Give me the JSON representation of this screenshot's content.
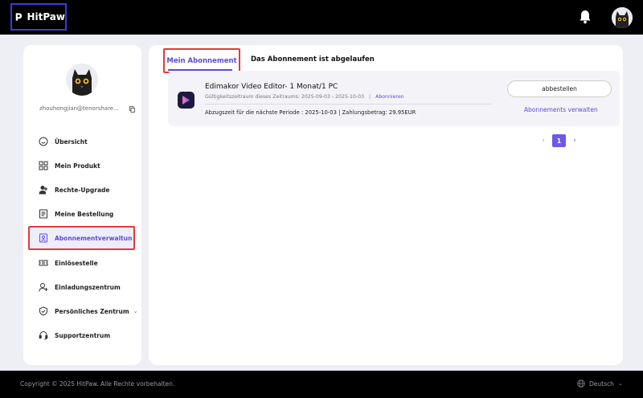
{
  "header": {
    "logo_text": "HitPaw"
  },
  "sidebar": {
    "email": "zhouhongjian@tenorshare...",
    "items": [
      {
        "label": "Übersicht",
        "icon": "smile-icon"
      },
      {
        "label": "Mein Produkt",
        "icon": "grid-icon"
      },
      {
        "label": "Rechte-Upgrade",
        "icon": "user-plus-icon"
      },
      {
        "label": "Meine Bestellung",
        "icon": "document-icon"
      },
      {
        "label": "Abonnementverwaltun",
        "icon": "subscription-icon"
      },
      {
        "label": "Einlösestelle",
        "icon": "ticket-icon"
      },
      {
        "label": "Einladungszentrum",
        "icon": "invite-icon"
      },
      {
        "label": "Persönliches Zentrum",
        "icon": "shield-icon"
      },
      {
        "label": "Supportzentrum",
        "icon": "headset-icon"
      }
    ]
  },
  "main": {
    "tabs": [
      {
        "label": "Mein Abonnement"
      },
      {
        "label": "Das Abonnement ist abgelaufen"
      }
    ],
    "subscription": {
      "product_name": "Edimakor Video Editor- 1 Monat/1 PC",
      "validity": "Gültigkeitszeitraum dieses Zeitraums: 2025-09-03 - 2025-10-03",
      "status": "Abonnieren",
      "next_period": "Abzugszeit für die nächste Periode : 2025-10-03 | Zahlungsbetrag: 29.95EUR",
      "cancel_label": "abbestellen",
      "manage_label": "Abonnements verwalten"
    },
    "pagination": {
      "prev": "‹",
      "current": "1",
      "next": "›"
    }
  },
  "footer": {
    "copyright": "Copyright © 2025 HitPaw. Alle Rechte vorbehalten.",
    "language": "Deutsch"
  },
  "colors": {
    "accent": "#5b4bdb",
    "highlight_border": "#e03b3b",
    "header_bg": "#000000",
    "page_bg": "#eeeef5"
  }
}
